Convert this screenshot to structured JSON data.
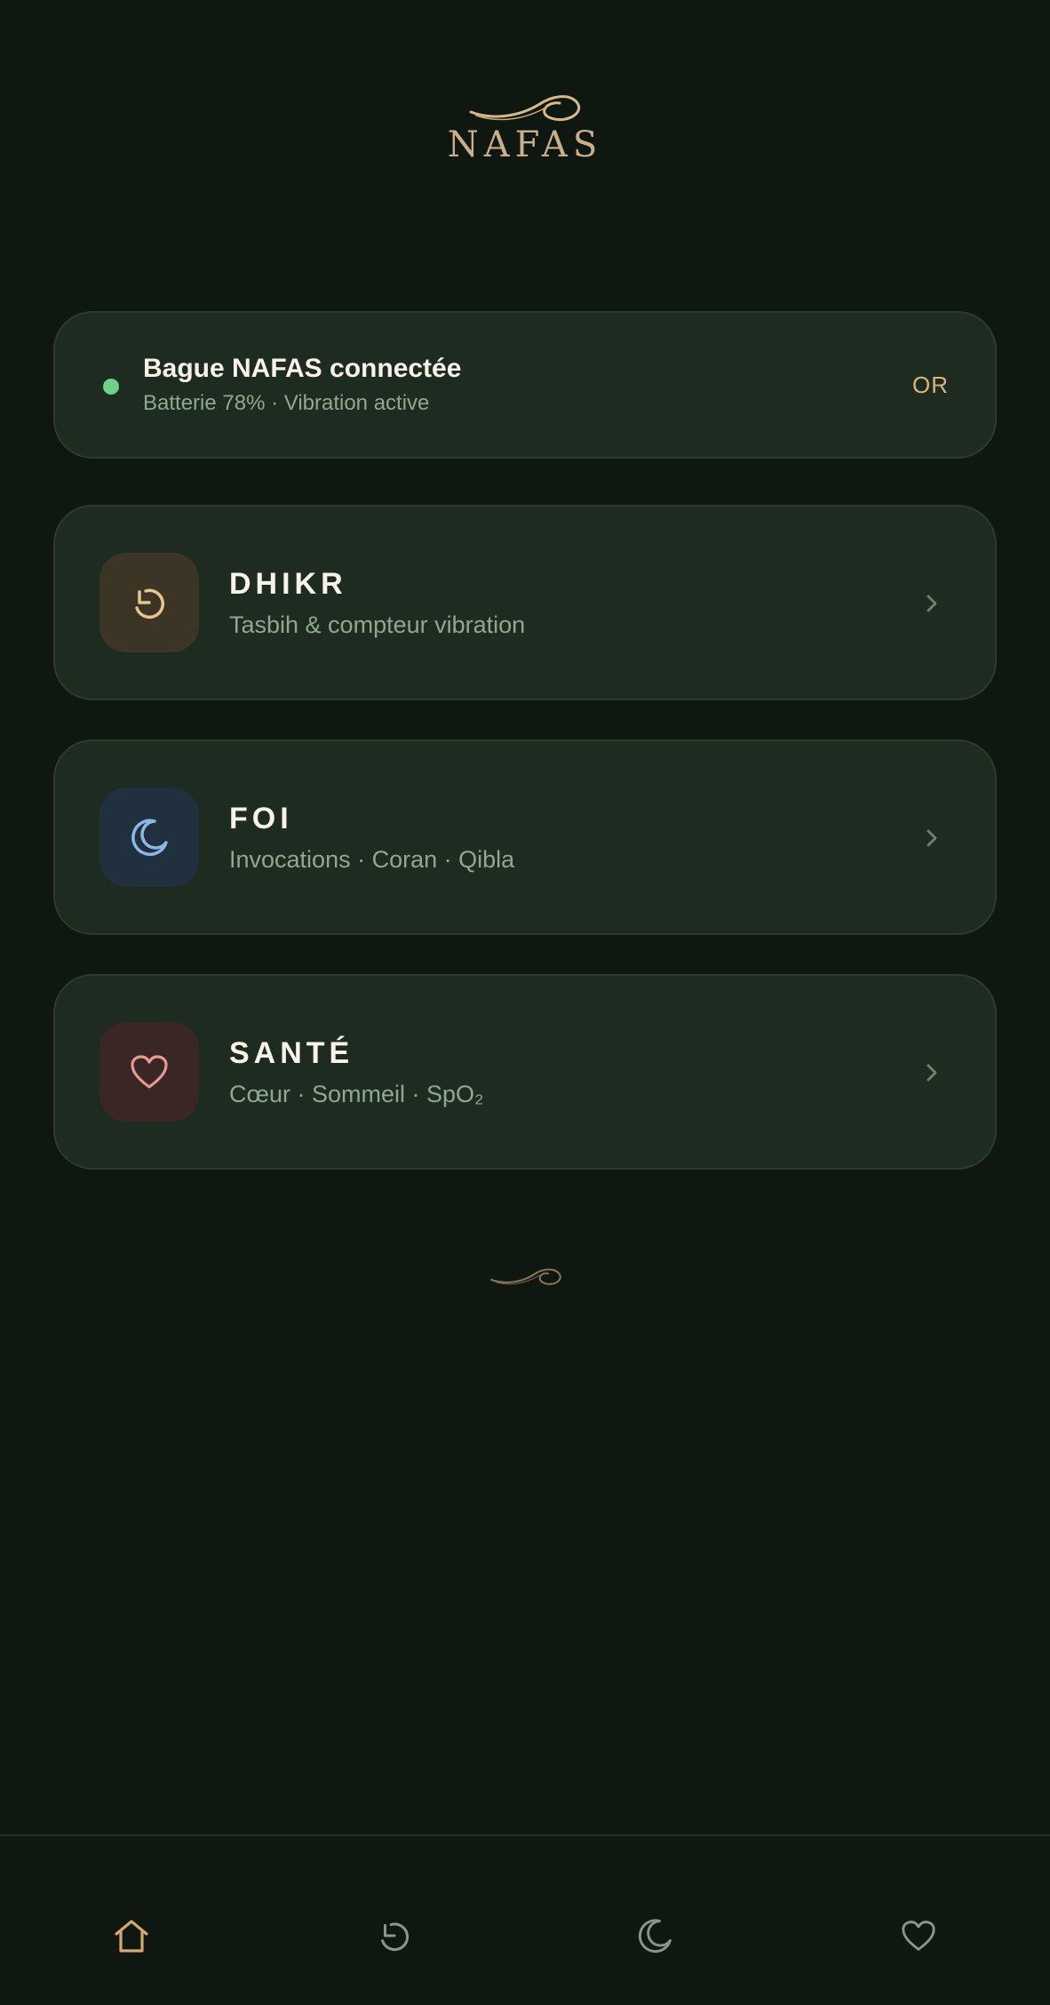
{
  "app": {
    "logo_text": "NAFAS"
  },
  "device": {
    "status": "Bague NAFAS connectée",
    "details": "Batterie 78% · Vibration active",
    "tier": "OR",
    "status_color": "#6fd08a"
  },
  "sections": [
    {
      "id": "dhikr",
      "title": "DHIKR",
      "subtitle": "Tasbih & compteur vibration",
      "icon": "counter-icon",
      "accent": "#e8c48e"
    },
    {
      "id": "foi",
      "title": "FOI",
      "subtitle": "Invocations · Coran · Qibla",
      "icon": "crescent-moon-icon",
      "accent": "#8cb8e8"
    },
    {
      "id": "sante",
      "title": "SANTÉ",
      "subtitle": "Cœur · Sommeil · SpO₂",
      "icon": "heart-icon",
      "accent": "#e59a93"
    }
  ],
  "bottom_nav": [
    {
      "id": "home",
      "icon": "home-icon",
      "active": true
    },
    {
      "id": "dhikr",
      "icon": "counter-icon",
      "active": false
    },
    {
      "id": "foi",
      "icon": "crescent-moon-icon",
      "active": false
    },
    {
      "id": "sante",
      "icon": "heart-icon",
      "active": false
    }
  ],
  "colors": {
    "background": "#0f1711",
    "card": "#1e2b20",
    "gold": "#d6b67a",
    "muted": "#8fa88f"
  }
}
